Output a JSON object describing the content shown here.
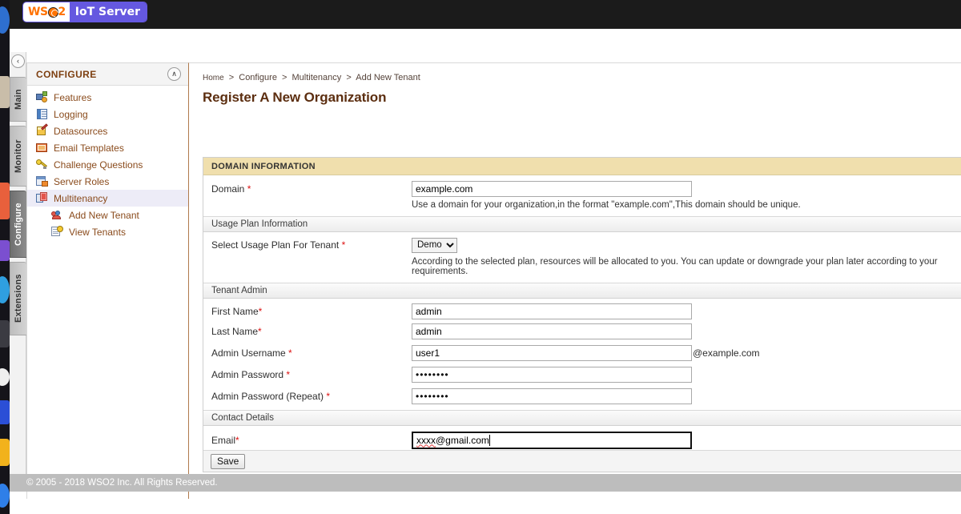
{
  "topbar": {
    "logo_mark": "WS",
    "logo_mark_suffix": "2",
    "logo_sub": "IoT Server",
    "brand_white": "#ffffff",
    "brand_orange": "#ff7300",
    "brand_purple": "#6558e0",
    "bar_bg": "#1b1b1b"
  },
  "rail": {
    "collapse_icon": "‹",
    "collapse_icon_name": "chevron-left-icon",
    "tabs": [
      {
        "label": "Main",
        "selected": false
      },
      {
        "label": "Monitor",
        "selected": false
      },
      {
        "label": "Configure",
        "selected": true
      },
      {
        "label": "Extensions",
        "selected": false
      }
    ]
  },
  "sidebar": {
    "title": "CONFIGURE",
    "collapse_icon": "∧",
    "collapse_icon_name": "chevron-up-icon",
    "items": [
      {
        "label": "Features",
        "icon": "features-icon",
        "selected": false,
        "sub": false
      },
      {
        "label": "Logging",
        "icon": "logging-icon",
        "selected": false,
        "sub": false
      },
      {
        "label": "Datasources",
        "icon": "datasources-icon",
        "selected": false,
        "sub": false
      },
      {
        "label": "Email Templates",
        "icon": "email-icon",
        "selected": false,
        "sub": false
      },
      {
        "label": "Challenge Questions",
        "icon": "key-icon",
        "selected": false,
        "sub": false
      },
      {
        "label": "Server Roles",
        "icon": "server-roles-icon",
        "selected": false,
        "sub": false
      },
      {
        "label": "Multitenancy",
        "icon": "multitenancy-icon",
        "selected": true,
        "sub": false
      },
      {
        "label": "Add New Tenant",
        "icon": "add-tenant-icon",
        "selected": false,
        "sub": true
      },
      {
        "label": "View Tenants",
        "icon": "view-tenants-icon",
        "selected": false,
        "sub": true
      }
    ]
  },
  "content": {
    "breadcrumb": [
      "Home",
      "Configure",
      "Multitenancy",
      "Add New Tenant"
    ],
    "breadcrumb_separator": ">",
    "page_title": "Register A New Organization"
  },
  "form": {
    "domain_section_title": "DOMAIN INFORMATION",
    "domain_section_bg": "#f0dfad",
    "domain": {
      "label": "Domain",
      "required": "*",
      "value": "example.com",
      "placeholder": "",
      "hint": "Use a domain for your organization,in the format \"example.com\",This domain should be unique."
    },
    "usage_plan_section_title": "Usage Plan Information",
    "usage_plan": {
      "label": "Select Usage Plan For Tenant",
      "required": "*",
      "selected": "Demo",
      "options": [
        "Demo"
      ],
      "hint": "According to the selected plan, resources will be allocated to you. You can update or downgrade your plan later according to your requirements."
    },
    "tenant_admin_section_title": "Tenant Admin",
    "first_name": {
      "label": "First Name",
      "required": "*",
      "value": "admin"
    },
    "last_name": {
      "label": "Last Name",
      "required": "*",
      "value": "admin"
    },
    "admin_username": {
      "label": "Admin Username",
      "required": "*",
      "value": "user1",
      "suffix": "@example.com"
    },
    "admin_password": {
      "label": "Admin Password",
      "required": "*",
      "value": "••••••••"
    },
    "admin_password_repeat": {
      "label": "Admin Password (Repeat)",
      "required": "*",
      "value": "••••••••"
    },
    "contact_section_title": "Contact Details",
    "email": {
      "label": "Email",
      "required": "*",
      "value_misspelled": "xxxx",
      "value_rest": "@gmail.com",
      "focused": true
    },
    "save_label": "Save"
  },
  "footer": {
    "text": "© 2005 - 2018 WSO2 Inc. All Rights Reserved.",
    "bg": "#bdbdbd"
  }
}
